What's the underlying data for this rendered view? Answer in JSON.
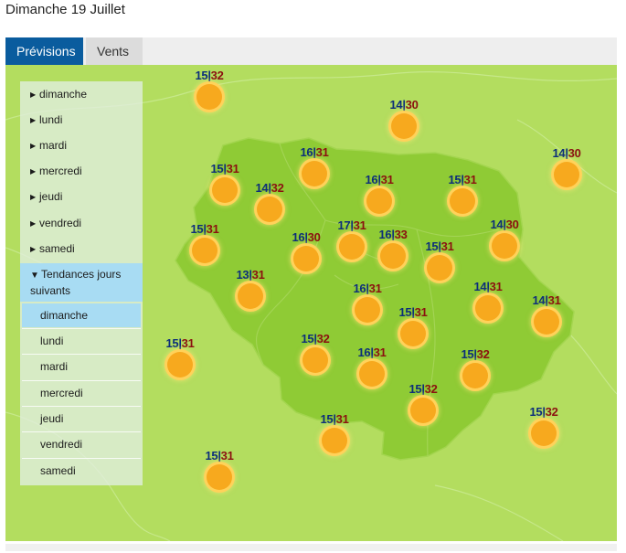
{
  "page": {
    "title": "Dimanche 19 Juillet"
  },
  "tabs": [
    {
      "label": "Prévisions"
    },
    {
      "label": "Vents"
    }
  ],
  "sidebar": {
    "days": [
      "dimanche",
      "lundi",
      "mardi",
      "mercredi",
      "jeudi",
      "vendredi",
      "samedi"
    ],
    "trend_header": "Tendances jours suivants",
    "trend_days": [
      "dimanche",
      "lundi",
      "mardi",
      "mercredi",
      "jeudi",
      "vendredi",
      "samedi"
    ],
    "selected_trend_day": "dimanche"
  },
  "colors": {
    "tab_active": "#0a5c9e",
    "map_outer": "#b3dd5f",
    "map_region": "#8fcb35",
    "sun": "#f7a91e",
    "tmin": "#0c2e7a",
    "tmax": "#8b1010",
    "selected": "#a8dcf3"
  },
  "forecast_markers": [
    {
      "min": "15",
      "max": "32"
    },
    {
      "min": "14",
      "max": "30"
    },
    {
      "min": "14",
      "max": "30"
    },
    {
      "min": "16",
      "max": "31"
    },
    {
      "min": "15",
      "max": "31"
    },
    {
      "min": "14",
      "max": "32"
    },
    {
      "min": "16",
      "max": "31"
    },
    {
      "min": "15",
      "max": "31"
    },
    {
      "min": "15",
      "max": "31"
    },
    {
      "min": "16",
      "max": "30"
    },
    {
      "min": "17",
      "max": "31"
    },
    {
      "min": "16",
      "max": "33"
    },
    {
      "min": "15",
      "max": "31"
    },
    {
      "min": "14",
      "max": "30"
    },
    {
      "min": "13",
      "max": "31"
    },
    {
      "min": "16",
      "max": "31"
    },
    {
      "min": "14",
      "max": "31"
    },
    {
      "min": "14",
      "max": "31"
    },
    {
      "min": "15",
      "max": "31"
    },
    {
      "min": "15",
      "max": "31"
    },
    {
      "min": "15",
      "max": "32"
    },
    {
      "min": "16",
      "max": "31"
    },
    {
      "min": "15",
      "max": "32"
    },
    {
      "min": "15",
      "max": "32"
    },
    {
      "min": "15",
      "max": "31"
    },
    {
      "min": "15",
      "max": "32"
    },
    {
      "min": "15",
      "max": "31"
    }
  ]
}
